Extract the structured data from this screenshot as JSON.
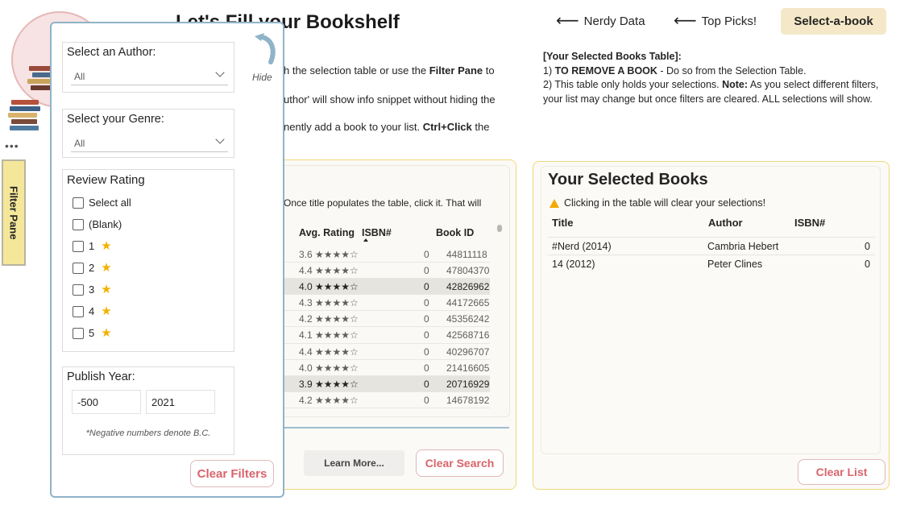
{
  "header": {
    "title": "Let's Fill your Bookshelf",
    "nav": [
      {
        "label": "Nerdy Data"
      },
      {
        "label": "Top Picks!"
      }
    ],
    "active_button": "Select-a-book"
  },
  "intro": {
    "line1_a": "h the selection table or use the ",
    "line1_b": "Filter Pane",
    "line1_c": " to",
    "line2": "uthor' will show info snippet without hiding the",
    "line3_a": "nently add a book to your list. ",
    "line3_b": "Ctrl+Click",
    "line3_c": " the"
  },
  "selected_info": {
    "heading": "[Your Selected Books Table]:",
    "item1_prefix": "1) ",
    "item1_bold": "TO REMOVE A BOOK",
    "item1_rest": " -  Do so from the Selection Table.",
    "item2_prefix": "2) This table only holds your selections. ",
    "item2_bold": "Note:",
    "item2_rest": " As you select different filters, your list may change but once filters are cleared. ALL selections will show."
  },
  "selection_table": {
    "hint": "Once title populates the table, click it. That will",
    "columns": {
      "rating": "Avg. Rating",
      "isbn": "ISBN#",
      "book_id": "Book ID"
    },
    "rows": [
      {
        "rating": "3.6 ★★★★☆",
        "isbn": "0",
        "book_id": "44811118",
        "highlight": false
      },
      {
        "rating": "4.4 ★★★★☆",
        "isbn": "0",
        "book_id": "47804370",
        "highlight": false
      },
      {
        "rating": "4.0 ★★★★☆",
        "isbn": "0",
        "book_id": "42826962",
        "highlight": true
      },
      {
        "rating": "4.3 ★★★★☆",
        "isbn": "0",
        "book_id": "44172665",
        "highlight": false
      },
      {
        "rating": "4.2 ★★★★☆",
        "isbn": "0",
        "book_id": "45356242",
        "highlight": false
      },
      {
        "rating": "4.1 ★★★★☆",
        "isbn": "0",
        "book_id": "42568716",
        "highlight": false
      },
      {
        "rating": "4.4 ★★★★☆",
        "isbn": "0",
        "book_id": "40296707",
        "highlight": false
      },
      {
        "rating": "4.0 ★★★★☆",
        "isbn": "0",
        "book_id": "21416605",
        "highlight": false
      },
      {
        "rating": "3.9 ★★★★☆",
        "isbn": "0",
        "book_id": "20716929",
        "highlight": true
      },
      {
        "rating": "4.2 ★★★★☆",
        "isbn": "0",
        "book_id": "14678192",
        "highlight": false
      }
    ],
    "learn_more": "Learn More...",
    "clear_search": "Clear Search"
  },
  "selected_books": {
    "title": "Your Selected Books",
    "warning": "Clicking in the table will clear your selections!",
    "columns": {
      "title": "Title",
      "author": "Author",
      "isbn": "ISBN#"
    },
    "rows": [
      {
        "title": "#Nerd (2014)",
        "author": "Cambria Hebert",
        "isbn": "0"
      },
      {
        "title": "14 (2012)",
        "author": "Peter Clines",
        "isbn": "0"
      }
    ],
    "clear_list": "Clear List"
  },
  "filter_tab": {
    "label": "Filter Pane"
  },
  "filter_panel": {
    "hide_label": "Hide",
    "author": {
      "title": "Select an Author:",
      "value": "All"
    },
    "genre": {
      "title": "Select your Genre:",
      "value": "All"
    },
    "review": {
      "title": "Review Rating",
      "options": [
        "Select all",
        "(Blank)",
        "1",
        "2",
        "3",
        "4",
        "5"
      ]
    },
    "publish_year": {
      "title": "Publish Year:",
      "min": "-500",
      "max": "2021",
      "note": "*Negative numbers denote B.C."
    },
    "clear_filters": "Clear Filters"
  },
  "colors": {
    "accent_yellow": "#f0d97a",
    "button_cream": "#f4e8c8",
    "clear_red": "#d9646b",
    "panel_border": "#8fb3c8"
  }
}
